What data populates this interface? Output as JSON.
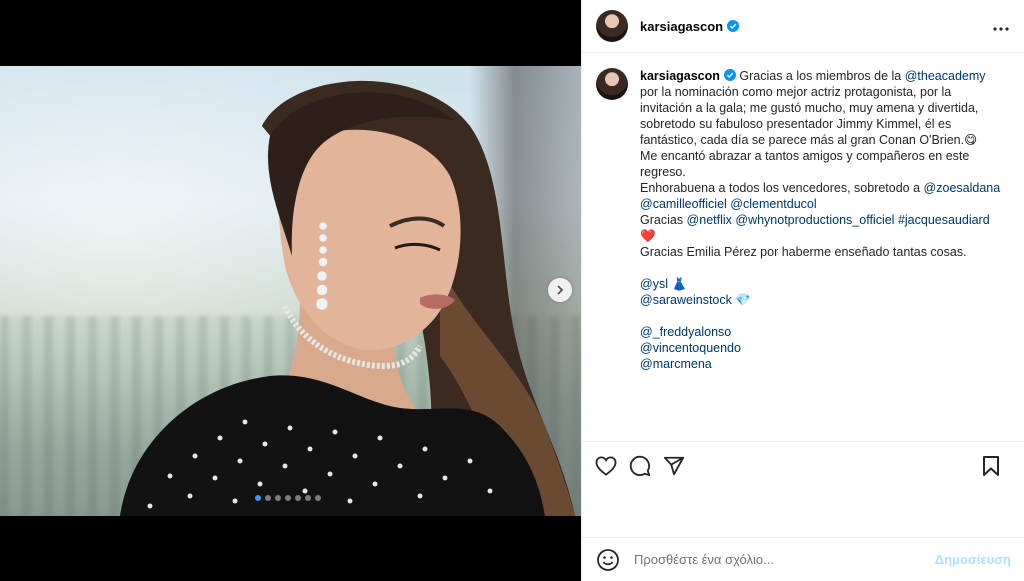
{
  "post": {
    "username": "karsiagascon",
    "verified": true,
    "media_slides": 7,
    "active_slide": 1
  },
  "caption": {
    "username": "karsiagascon",
    "lines": [
      [
        "text",
        " Gracias a los miembros de la "
      ],
      [
        "mention",
        "@theacademy"
      ],
      [
        "text",
        " por la nominación como mejor actriz protagonista, por la invitación a la gala; me gustó mucho, muy amena y divertida, sobretodo su fabuloso presentador Jimmy Kimmel, él es fantástico, cada día se parece más al gran Conan O'Brien.😋"
      ]
    ],
    "p2": "Me encantó abrazar a tantos amigos y compañeros en este regreso.",
    "p3_text": "Enhorabuena a todos los vencedores, sobretodo a ",
    "p3_m1": "@zoesaldana",
    "p3_m2": "@camilleofficiel",
    "p3_m3": "@clementducol",
    "p4_text": "Gracias ",
    "p4_m1": "@netflix",
    "p4_m2": "@whynotproductions_officiel",
    "p4_m3": "#jacquesaudiard",
    "p4_emoji": "❤️",
    "p5": "Gracias Emilia Pérez por haberme enseñado tantas cosas.",
    "m_ysl": "@ysl",
    "e_ysl": "👗",
    "m_sara": "@saraweinstock",
    "e_sara": "💎",
    "m_freddy": "@_freddyalonso",
    "m_vincent": "@vincentoquendo",
    "m_marc": "@marcmena"
  },
  "comment_box": {
    "placeholder": "Προσθέστε ένα σχόλιο...",
    "post_label": "Δημοσίευση"
  },
  "icons": {
    "verified": "verified-badge-icon",
    "more": "more-options-icon",
    "like": "heart-icon",
    "comment": "comment-icon",
    "share": "send-icon",
    "save": "bookmark-icon",
    "emoji": "emoji-icon",
    "next": "chevron-right-icon"
  },
  "colors": {
    "mention": "#00376b",
    "verified": "#0095f6",
    "post_button": "#b2dffc"
  }
}
